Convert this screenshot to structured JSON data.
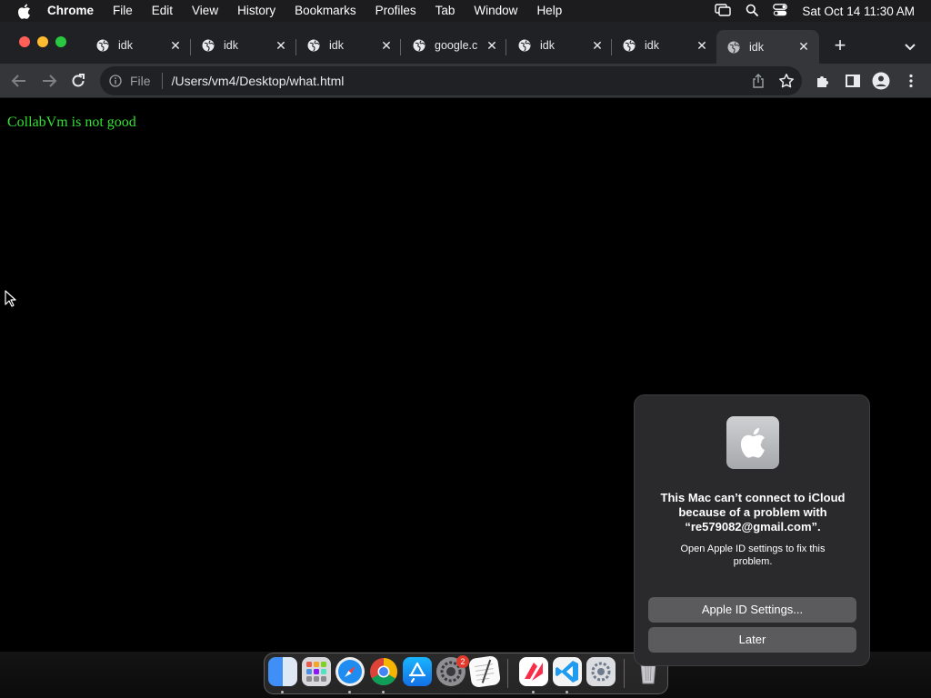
{
  "menubar": {
    "app_name": "Chrome",
    "items": [
      "File",
      "Edit",
      "View",
      "History",
      "Bookmarks",
      "Profiles",
      "Tab",
      "Window",
      "Help"
    ],
    "clock": "Sat Oct 14  11:30 AM"
  },
  "tabs": [
    {
      "title": "idk",
      "active": false
    },
    {
      "title": "idk",
      "active": false
    },
    {
      "title": "idk",
      "active": false
    },
    {
      "title": "google.c",
      "active": false
    },
    {
      "title": "idk",
      "active": false
    },
    {
      "title": "idk",
      "active": false
    },
    {
      "title": "idk",
      "active": true
    }
  ],
  "omnibox": {
    "scheme_label": "File",
    "url": "/Users/vm4/Desktop/what.html"
  },
  "page": {
    "text": "CollabVm is not good",
    "text_color": "#33e033"
  },
  "notification": {
    "title": "This Mac can’t connect to iCloud because of a problem with “re579082@gmail.com”.",
    "body": "Open Apple ID settings to fix this problem.",
    "primary_button": "Apple ID Settings...",
    "secondary_button": "Later"
  },
  "dock": {
    "apps": [
      "Finder",
      "Launchpad",
      "Safari",
      "Google Chrome",
      "App Store",
      "System Preferences",
      "TextEdit",
      "News",
      "Visual Studio Code",
      "Utility",
      "Trash"
    ],
    "system_prefs_badge": "2"
  }
}
